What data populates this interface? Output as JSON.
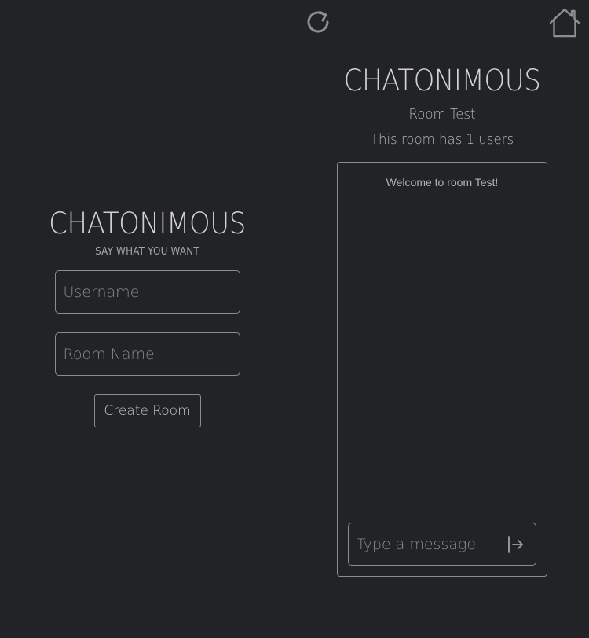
{
  "header": {
    "refresh_icon": "refresh-icon",
    "home_icon": "home-icon"
  },
  "create_panel": {
    "logo": "CHATONIMOUS",
    "tagline": "SAY WHAT YOU WANT",
    "username_placeholder": "Username",
    "username_value": "",
    "room_placeholder": "Room Name",
    "room_value": "",
    "create_label": "Create Room"
  },
  "chat_panel": {
    "logo": "CHATONIMOUS",
    "room_title": "Room Test",
    "room_users": "This room has 1 users",
    "messages": [
      {
        "text": "Welcome to room Test!"
      }
    ],
    "message_placeholder": "Type a message",
    "message_value": "",
    "send_icon": "send-arrow-icon"
  },
  "colors": {
    "background": "#222327",
    "border": "#8c8c90",
    "text": "#c9c9cc"
  }
}
